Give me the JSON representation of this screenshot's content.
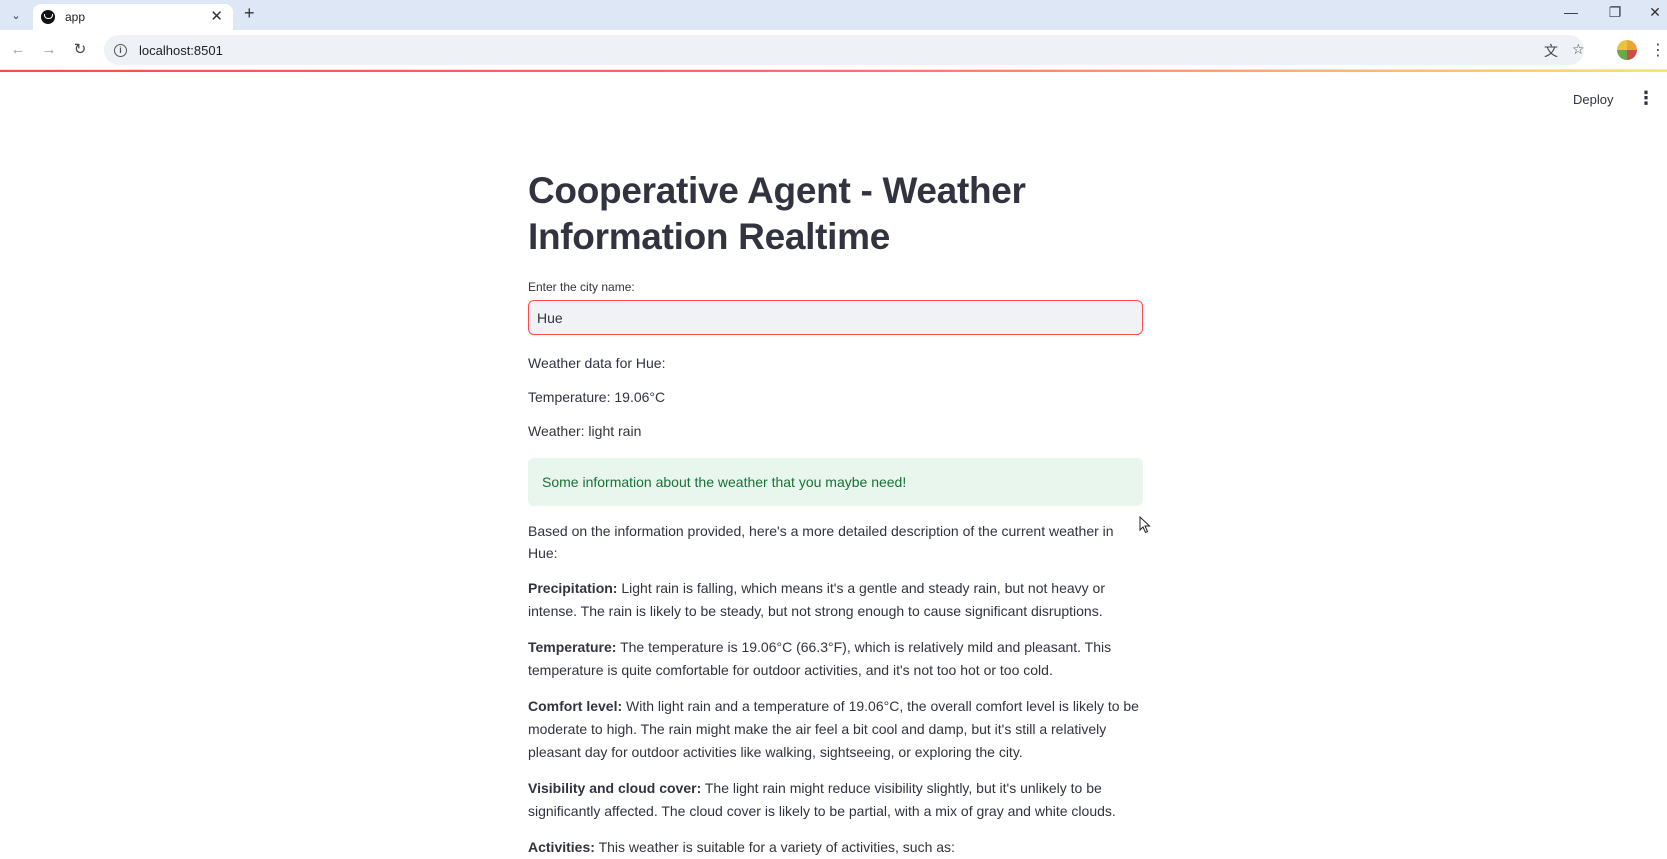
{
  "browser": {
    "tab_title": "app",
    "url": "localhost:8501",
    "icons": {
      "tab_list": "chevron-down-icon",
      "favicon": "streamlit-icon",
      "tab_close": "close-icon",
      "new_tab": "plus-icon",
      "minimize": "minimize-icon",
      "restore": "restore-icon",
      "close_window": "close-icon",
      "back": "back-arrow-icon",
      "forward": "forward-arrow-icon",
      "reload": "reload-icon",
      "site_info": "info-icon",
      "translate": "translate-icon",
      "bookmark": "star-icon",
      "profile": "profile-avatar-icon",
      "menu": "kebab-menu-icon"
    }
  },
  "header": {
    "deploy_label": "Deploy",
    "menu_icon": "kebab-menu-icon"
  },
  "main": {
    "title": "Cooperative Agent - Weather Information Realtime",
    "input_label": "Enter the city name:",
    "input_value": "Hue",
    "weather_for": "Weather data for Hue:",
    "temperature": "Temperature: 19.06°C",
    "weather": "Weather: light rain",
    "success_message": "Some information about the weather that you maybe need!",
    "intro": "Based on the information provided, here's a more detailed description of the current weather in Hue:",
    "sections": [
      {
        "heading": "Precipitation:",
        "text": "Light rain is falling, which means it's a gentle and steady rain, but not heavy or intense. The rain is likely to be steady, but not strong enough to cause significant disruptions."
      },
      {
        "heading": "Temperature:",
        "text": "The temperature is 19.06°C (66.3°F), which is relatively mild and pleasant. This temperature is quite comfortable for outdoor activities, and it's not too hot or too cold."
      },
      {
        "heading": "Comfort level:",
        "text": "With light rain and a temperature of 19.06°C, the overall comfort level is likely to be moderate to high. The rain might make the air feel a bit cool and damp, but it's still a relatively pleasant day for outdoor activities like walking, sightseeing, or exploring the city."
      },
      {
        "heading": "Visibility and cloud cover:",
        "text": "The light rain might reduce visibility slightly, but it's unlikely to be significantly affected. The cloud cover is likely to be partial, with a mix of gray and white clouds."
      },
      {
        "heading": "Activities:",
        "text": "This weather is suitable for a variety of activities, such as:"
      }
    ]
  },
  "colors": {
    "accent": "#ff4b4b",
    "success_bg": "#e9f6ee",
    "success_text": "#177233",
    "text": "#31333f",
    "tabbar_bg": "#dde7f6"
  }
}
